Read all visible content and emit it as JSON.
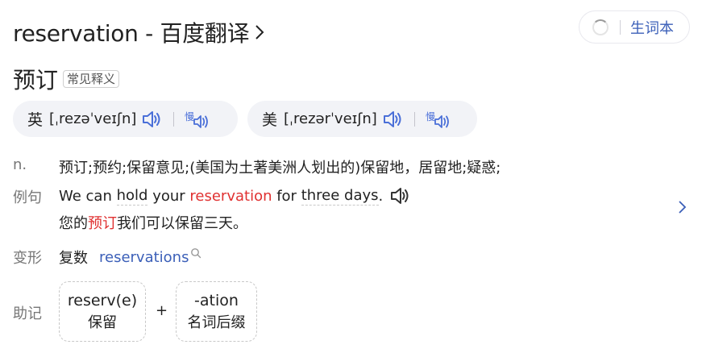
{
  "header": {
    "title": "reservation - 百度翻译",
    "wordbook_label": "生词本"
  },
  "entry": {
    "headword": "预订",
    "common_tag": "常见释义"
  },
  "pronunciation": {
    "uk": {
      "region": "英",
      "ipa": "[ˌrezəˈveɪʃn]"
    },
    "us": {
      "region": "美",
      "ipa": "[ˌrezərˈveɪʃn]"
    }
  },
  "definition": {
    "pos": "n.",
    "text": "预订;预约;保留意见;(美国为土著美洲人划出的)保留地，居留地;疑惑;"
  },
  "example": {
    "label": "例句",
    "en_parts": [
      "We can ",
      "hold",
      " your ",
      "reservation",
      " for ",
      "three days",
      "."
    ],
    "zh_before": "您的",
    "zh_highlight": "预订",
    "zh_after": "我们可以保留三天。"
  },
  "forms": {
    "label": "变形",
    "type": "复数",
    "word": "reservations"
  },
  "morphology": {
    "label": "助记",
    "plus": "+",
    "parts": [
      {
        "part": "reserv(e)",
        "meaning": "保留"
      },
      {
        "part": "-ation",
        "meaning": "名词后缀"
      }
    ]
  },
  "colors": {
    "accent_blue": "#3b5fb8",
    "icon_blue": "#4a6fd8",
    "highlight_red": "#e03131",
    "label_gray": "#777777",
    "pill_bg": "#f2f3f7"
  }
}
